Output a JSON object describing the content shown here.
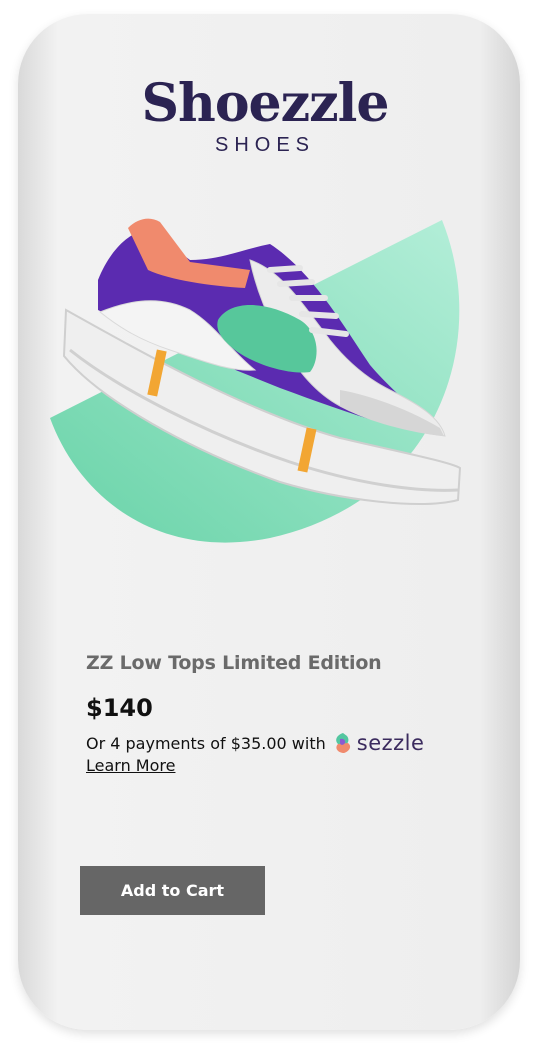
{
  "brand": {
    "name": "Shoezzle",
    "tagline": "SHOES"
  },
  "product": {
    "title": "ZZ Low Tops Limited Edition",
    "price": "$140",
    "image_icon": "sneaker-image"
  },
  "payment": {
    "installment_text": "Or 4 payments of $35.00 with",
    "provider_name": "sezzle",
    "learn_more_label": "Learn More"
  },
  "actions": {
    "add_to_cart_label": "Add to Cart"
  },
  "colors": {
    "brand_text": "#2b2352",
    "accent_mint": "#7fdcb8",
    "button_gray": "#666666",
    "shoe_purple": "#5b2bb0",
    "shoe_coral": "#f08a6d"
  }
}
